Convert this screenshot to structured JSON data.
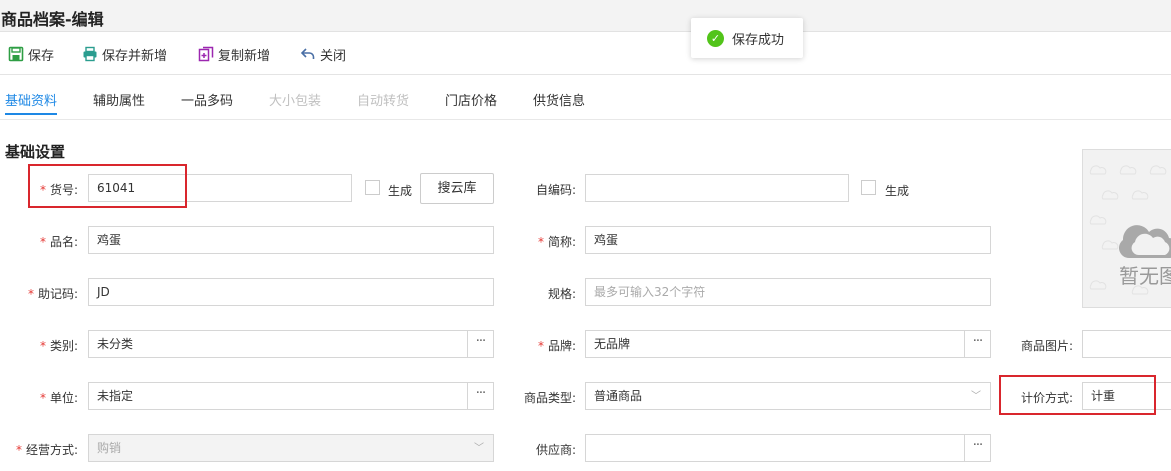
{
  "window": {
    "title": "商品档案-编辑"
  },
  "toolbar": {
    "save": "保存",
    "save_and_new": "保存并新增",
    "copy_new": "复制新增",
    "close": "关闭"
  },
  "toast": {
    "message": "保存成功"
  },
  "tabs": [
    {
      "label": "基础资料",
      "state": "active"
    },
    {
      "label": "辅助属性",
      "state": "normal"
    },
    {
      "label": "一品多码",
      "state": "normal"
    },
    {
      "label": "大小包装",
      "state": "disabled"
    },
    {
      "label": "自动转货",
      "state": "disabled"
    },
    {
      "label": "门店价格",
      "state": "normal"
    },
    {
      "label": "供货信息",
      "state": "normal"
    }
  ],
  "section": {
    "title": "基础设置"
  },
  "form": {
    "item_no": {
      "label": "货号:",
      "value": "61041",
      "generate_label": "生成",
      "cloud_button": "搜云库"
    },
    "self_code": {
      "label": "自编码:",
      "value": "",
      "generate_label": "生成"
    },
    "name": {
      "label": "品名:",
      "value": "鸡蛋"
    },
    "short_name": {
      "label": "简称:",
      "value": "鸡蛋"
    },
    "mnemonic": {
      "label": "助记码:",
      "value": "JD"
    },
    "spec": {
      "label": "规格:",
      "placeholder": "最多可输入32个字符"
    },
    "category": {
      "label": "类别:",
      "value": "未分类"
    },
    "brand": {
      "label": "品牌:",
      "value": "无品牌"
    },
    "product_image": {
      "label": "商品图片:",
      "value": ""
    },
    "unit": {
      "label": "单位:",
      "value": "未指定"
    },
    "product_type": {
      "label": "商品类型:",
      "value": "普通商品"
    },
    "pricing": {
      "label": "计价方式:",
      "value": "计重"
    },
    "business_mode": {
      "label": "经营方式:",
      "value": "购销"
    },
    "supplier": {
      "label": "供应商:",
      "value": ""
    }
  },
  "image_placeholder": {
    "text": "暂无图"
  },
  "required_mark": "*",
  "more_glyph": "···",
  "colors": {
    "accent": "#1e88e5",
    "required": "#e53935",
    "highlight_box": "#d9262d",
    "success": "#52c41a"
  }
}
